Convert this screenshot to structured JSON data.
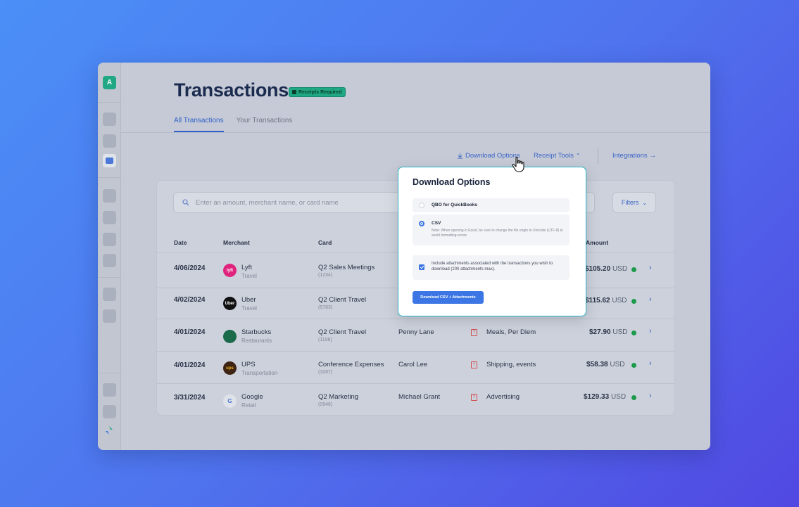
{
  "sidebar": {
    "avatar_letter": "A"
  },
  "header": {
    "title": "Transactions",
    "badge": "Receipts Required",
    "tabs": [
      "All Transactions",
      "Your Transactions"
    ]
  },
  "toolbar": {
    "download_options": "Download Options",
    "receipt_tools": "Receipt Tools",
    "integrations": "Integrations"
  },
  "search": {
    "placeholder": "Enter an amount, merchant name, or card name"
  },
  "filters_label": "Filters",
  "table": {
    "headers": {
      "date": "Date",
      "merchant": "Merchant",
      "card": "Card",
      "amount": "Amount"
    },
    "rows": [
      {
        "date": "4/06/2024",
        "merchant": "Lyft",
        "category": "Travel",
        "card": "Q2 Sales Meetings",
        "card_no": "(1234)",
        "person": "",
        "purpose": "",
        "amount": "$105.20",
        "currency": "USD",
        "logo_text": "lyft"
      },
      {
        "date": "4/02/2024",
        "merchant": "Uber",
        "category": "Travel",
        "card": "Q2 Client Travel",
        "card_no": "(5783)",
        "person": "",
        "purpose": "",
        "amount": "$115.62",
        "currency": "USD",
        "logo_text": "Uber"
      },
      {
        "date": "4/01/2024",
        "merchant": "Starbucks",
        "category": "Restaurants",
        "card": "Q2 Client Travel",
        "card_no": "(1198)",
        "person": "Penny Lane",
        "purpose": "Meals, Per Diem",
        "amount": "$27.90",
        "currency": "USD",
        "logo_text": ""
      },
      {
        "date": "4/01/2024",
        "merchant": "UPS",
        "category": "Transportation",
        "card": "Conference Expenses",
        "card_no": "(3287)",
        "person": "Carol Lee",
        "purpose": "Shipping, events",
        "amount": "$58.38",
        "currency": "USD",
        "logo_text": "ups"
      },
      {
        "date": "3/31/2024",
        "merchant": "Google",
        "category": "Retail",
        "card": "Q2 Marketing",
        "card_no": "(0946)",
        "person": "Michael Grant",
        "purpose": "Advertising",
        "amount": "$129.33",
        "currency": "USD",
        "logo_text": "G"
      }
    ]
  },
  "modal": {
    "title": "Download Options",
    "option_qbo": "QBO for QuickBooks",
    "option_csv": "CSV",
    "csv_note": "Note: When opening in Excel, be sure to change the file origin to Unicode (UTF-8) to avoid formatting errors",
    "include_attachments": "Include attachments associated with the transactions you wish to download (200 attachments max).",
    "button": "Download CSV + Attachments"
  },
  "colors": {
    "accent": "#3c76e4",
    "badge": "#1fa883",
    "modal_border": "#24b2c9"
  }
}
